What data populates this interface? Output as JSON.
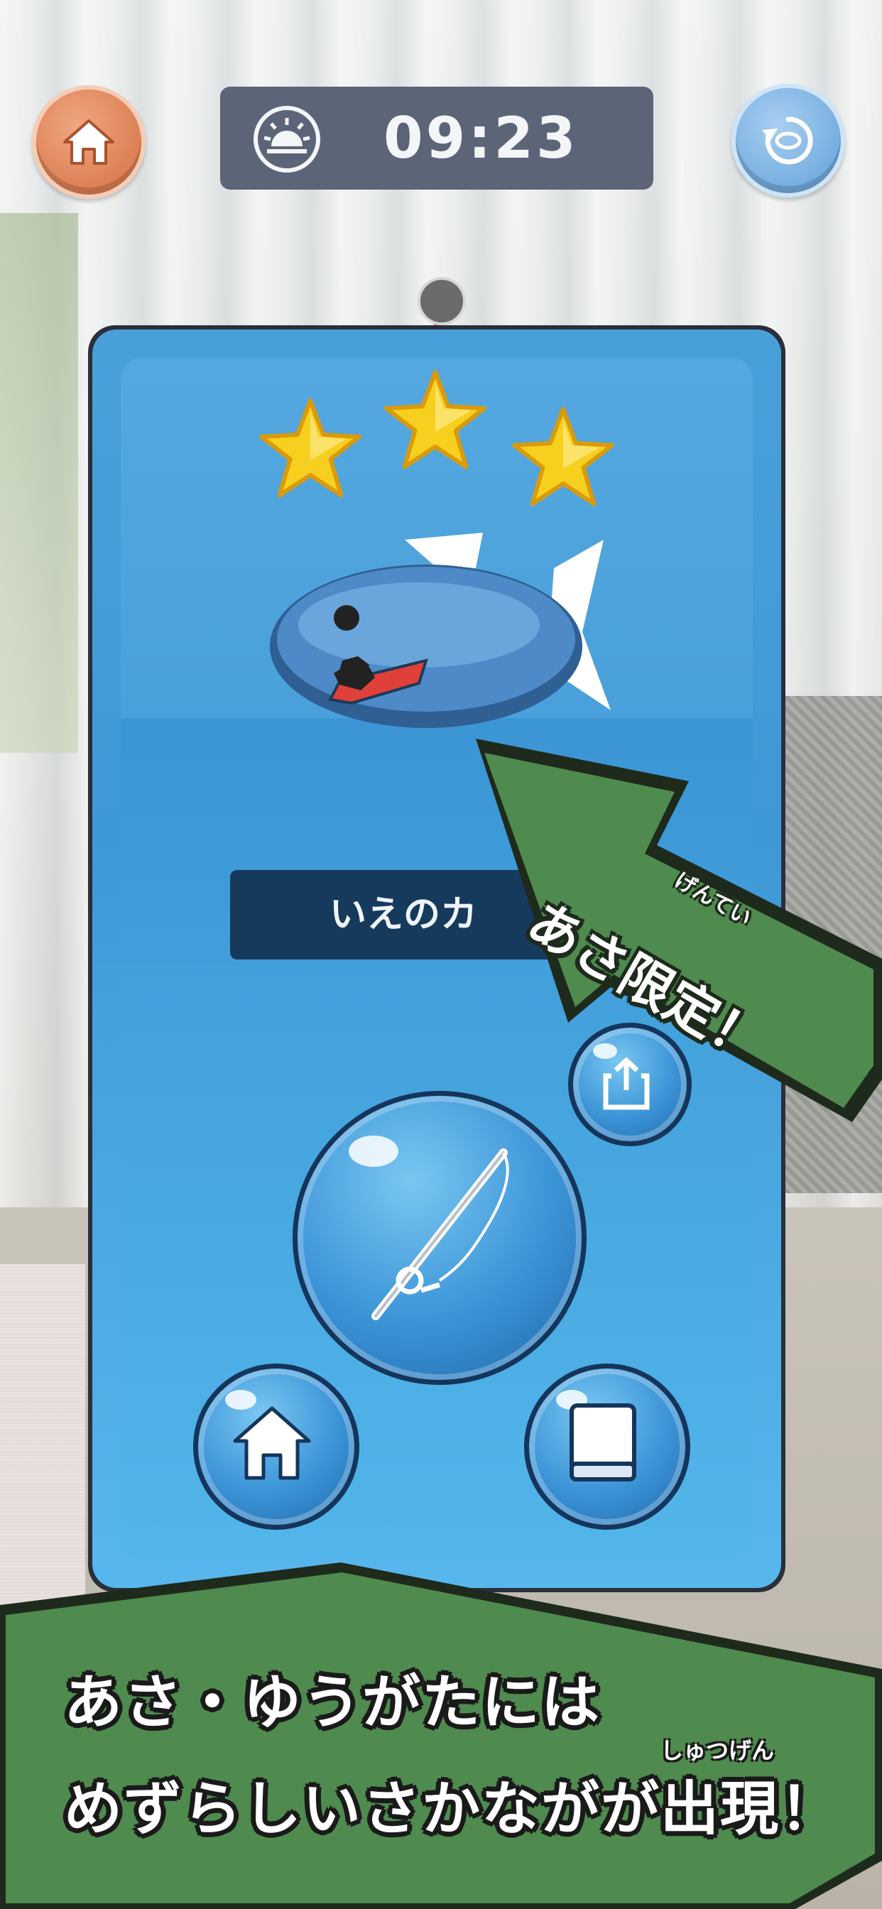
{
  "topbar": {
    "time": "09:23",
    "time_of_day_icon": "sunrise-icon",
    "home_icon": "home-icon",
    "reset_icon": "refresh-icon"
  },
  "result_card": {
    "stars": 3,
    "fish_name": "いえのカ",
    "share_icon": "share-icon",
    "fishing_icon": "fishing-rod-icon",
    "home_icon": "home-icon",
    "book_icon": "book-icon"
  },
  "arrow_callout": {
    "text": "あさ限定！",
    "ruby": "げんてい"
  },
  "bottom_banner": {
    "line1": "あさ・ゆうがたには",
    "line2": "めずらしいさかながが出現！",
    "ruby": "しゅつげん"
  },
  "colors": {
    "card_blue": "#3f98d6",
    "banner_green": "#4f8a4e",
    "plate_navy": "#153a5c",
    "star_yellow": "#f7cf1e"
  }
}
